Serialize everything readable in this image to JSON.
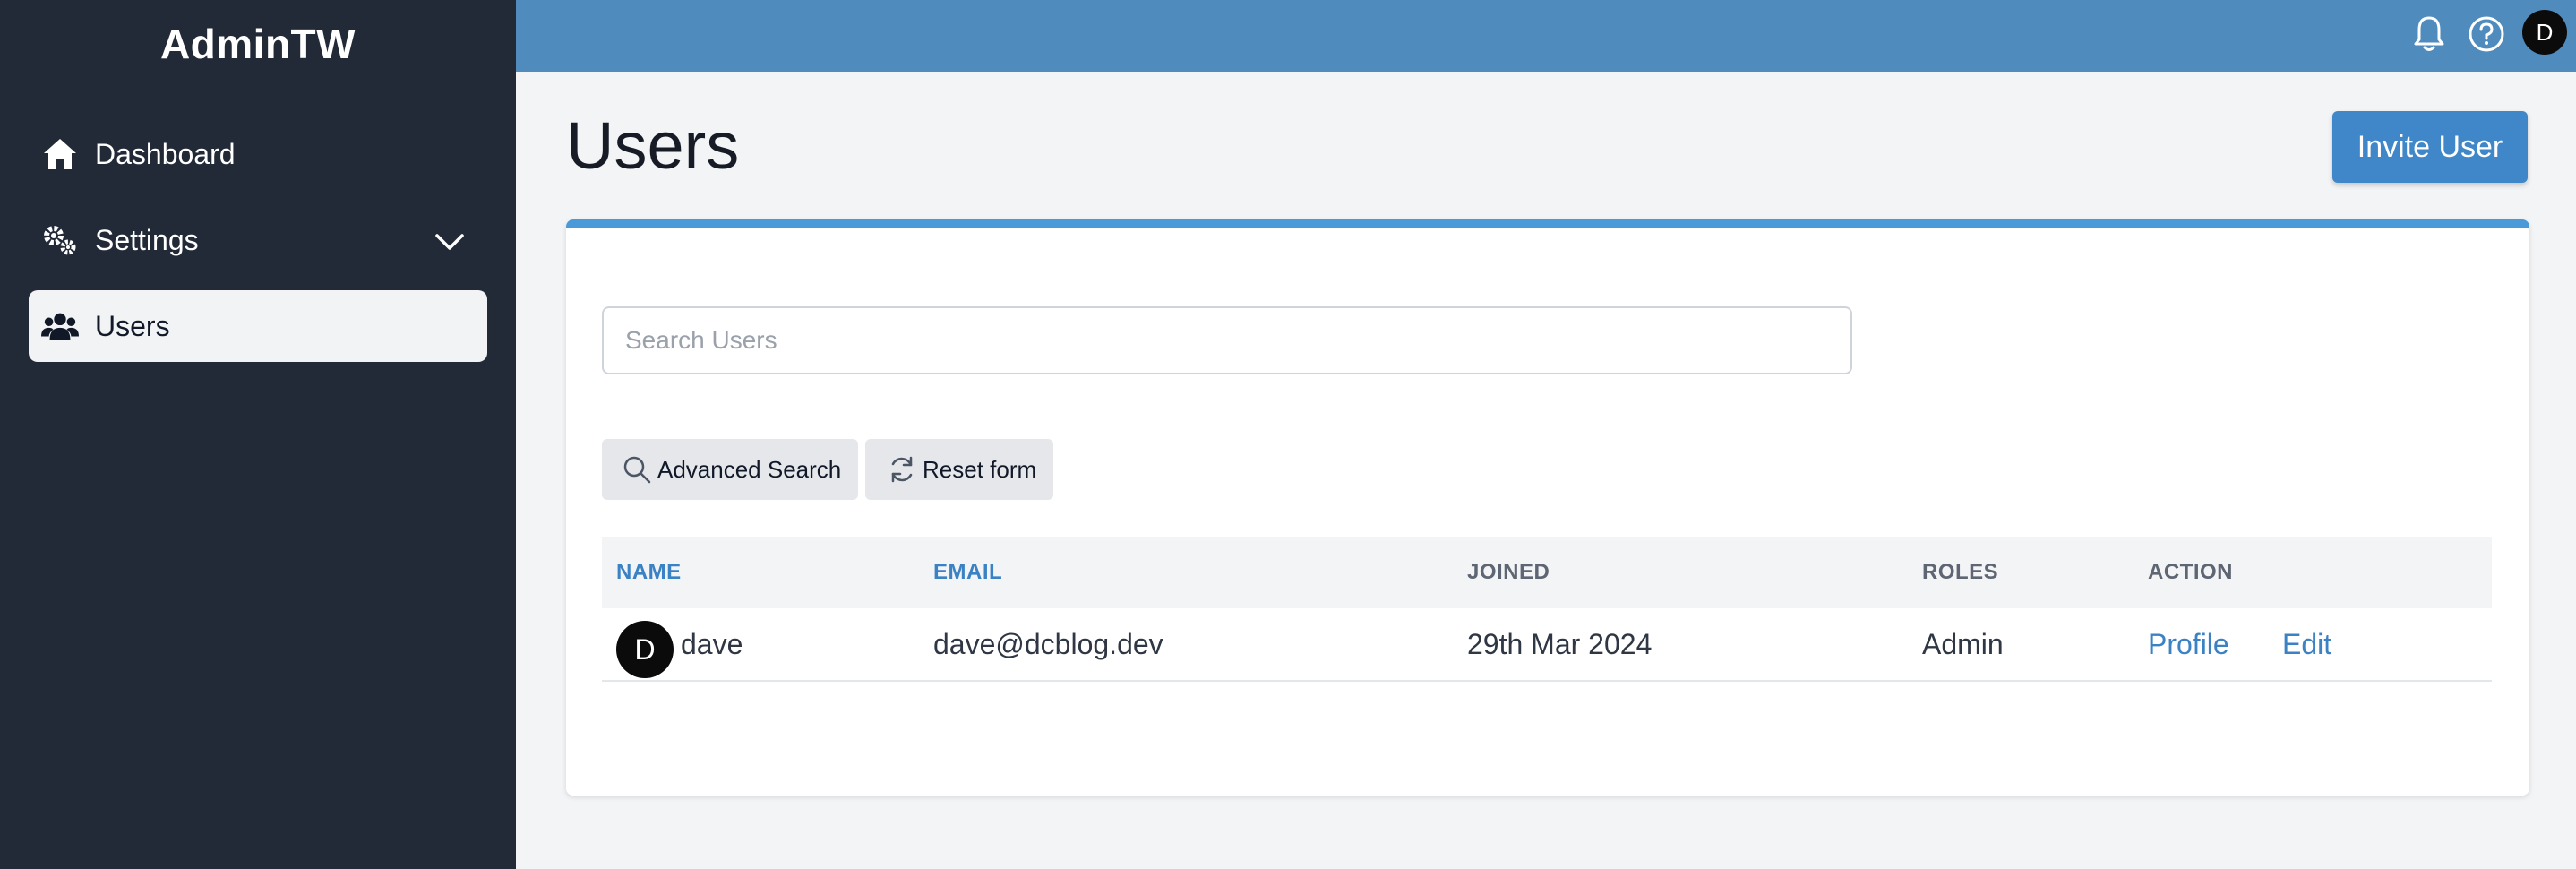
{
  "sidebar": {
    "brand": "AdminTW",
    "items": [
      {
        "label": "Dashboard",
        "icon": "home-icon"
      },
      {
        "label": "Settings",
        "icon": "gears-icon"
      },
      {
        "label": "Users",
        "icon": "users-icon"
      }
    ]
  },
  "topbar": {
    "avatar_initial": "D",
    "icons": [
      "bell-icon",
      "help-circle-icon"
    ]
  },
  "main": {
    "title": "Users",
    "invite_label": "Invite User",
    "search_placeholder": "Search Users",
    "advanced_search_label": "Advanced Search",
    "reset_label": "Reset form",
    "table": {
      "headers": [
        "NAME",
        "EMAIL",
        "JOINED",
        "ROLES",
        "ACTION"
      ],
      "rows": [
        {
          "avatar": "D",
          "name": "dave",
          "email": "dave@dcblog.dev",
          "joined": "29th Mar 2024",
          "roles": "Admin",
          "actions": [
            "Profile",
            "Edit"
          ]
        }
      ]
    }
  },
  "colors": {
    "sidebar_bg": "#222a38",
    "topbar_bg": "#508bbd",
    "accent": "#3f87c8",
    "link": "#3a82c4",
    "card_border": "#4a9ad9"
  }
}
